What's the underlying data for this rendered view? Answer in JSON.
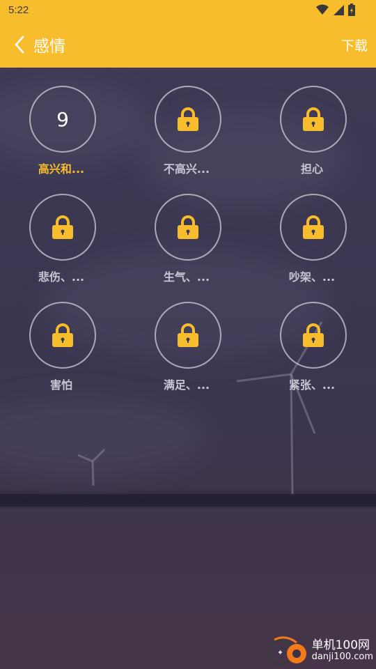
{
  "status_bar": {
    "time": "5:22"
  },
  "header": {
    "title": "感情",
    "download_label": "下载"
  },
  "grid": {
    "items": [
      {
        "label": "高兴和...",
        "count": "9",
        "locked": false,
        "active": true
      },
      {
        "label": "不高兴...",
        "locked": true
      },
      {
        "label": "担心",
        "locked": true
      },
      {
        "label": "悲伤、...",
        "locked": true
      },
      {
        "label": "生气、...",
        "locked": true
      },
      {
        "label": "吵架、...",
        "locked": true
      },
      {
        "label": "害怕",
        "locked": true
      },
      {
        "label": "满足、...",
        "locked": true
      },
      {
        "label": "紧张、...",
        "locked": true
      }
    ]
  },
  "watermark": {
    "title": "单机100网",
    "url": "danji100.com"
  },
  "colors": {
    "accent": "#f8bd2c",
    "lock": "#f8bd2c",
    "label": "#c9c6d2"
  }
}
